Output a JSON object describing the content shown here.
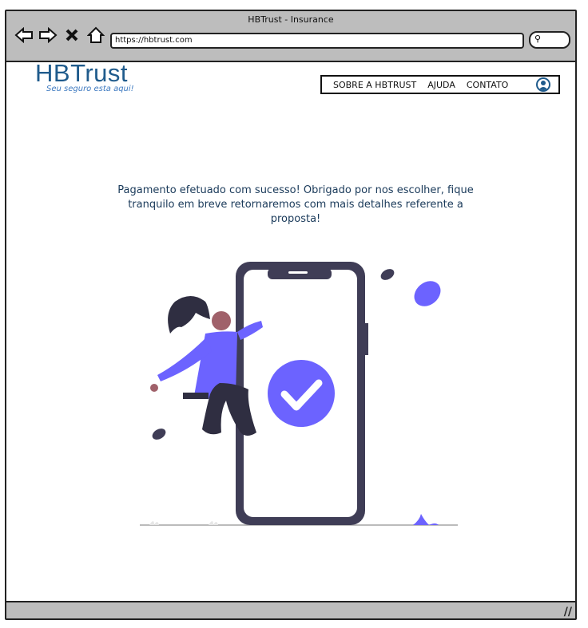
{
  "window": {
    "title": "HBTrust - Insurance",
    "url": "https://hbtrust.com"
  },
  "logo": {
    "name": "HBTrust",
    "tagline": "Seu seguro esta aqui!"
  },
  "nav": {
    "items": [
      "SOBRE A HBTRUST",
      "AJUDA",
      "CONTATO"
    ]
  },
  "message": "Pagamento efetuado com sucesso! Obrigado por nos escolher, fique tranquilo em breve retornaremos com mais detalhes referente a proposta!",
  "colors": {
    "brand": "#1f5b8c",
    "accent": "#6c63ff",
    "dark": "#3f3d56"
  },
  "icons": [
    "back-arrow-icon",
    "forward-arrow-icon",
    "close-icon",
    "home-icon",
    "search-icon",
    "user-icon",
    "check-icon"
  ]
}
